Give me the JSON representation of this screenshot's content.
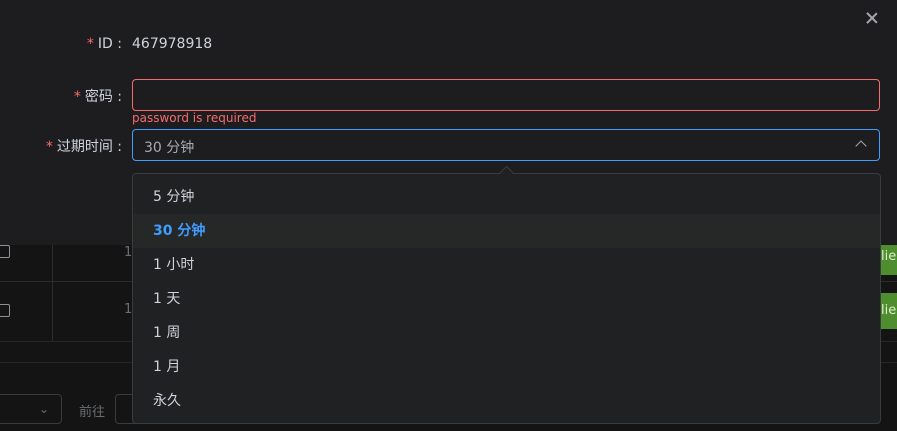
{
  "background": {
    "rows": [
      {
        "number": "1",
        "button_text": "lie"
      },
      {
        "number": "1",
        "button_text": "lie"
      }
    ],
    "pager": {
      "goto_label": "前往"
    }
  },
  "modal": {
    "id_field": {
      "label": "ID",
      "value": "467978918"
    },
    "password_field": {
      "label": "密码",
      "value": "",
      "error": "password is required"
    },
    "expire_field": {
      "label": "过期时间",
      "value": "30 分钟"
    },
    "expire_options": [
      "5 分钟",
      "30 分钟",
      "1 小时",
      "1 天",
      "1 周",
      "1 月",
      "永久"
    ],
    "selected_option_index": 1,
    "hovered_option_index": 1,
    "colors": {
      "primary": "#409eff",
      "danger": "#f56c6c"
    }
  }
}
